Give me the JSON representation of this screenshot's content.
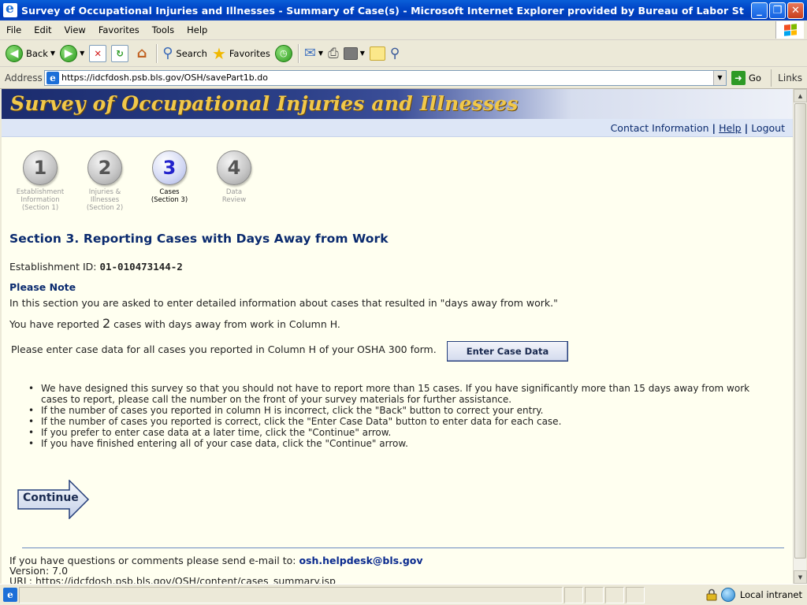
{
  "window": {
    "title": "Survey of Occupational Injuries and Illnesses - Summary of Case(s) - Microsoft Internet Explorer provided by Bureau of Labor St",
    "minimize": "_",
    "maximize": "❐",
    "close": "✕"
  },
  "menu": [
    "File",
    "Edit",
    "View",
    "Favorites",
    "Tools",
    "Help"
  ],
  "toolbar": {
    "back_label": "Back",
    "search_label": "Search",
    "favorites_label": "Favorites"
  },
  "address": {
    "label": "Address",
    "url": "https://idcfdosh.psb.bls.gov/OSH/savePart1b.do",
    "go_label": "Go",
    "links_label": "Links"
  },
  "banner": {
    "title": "Survey of Occupational Injuries and Illnesses"
  },
  "nav": {
    "contact": "Contact Information",
    "sep1": "|",
    "help": "Help",
    "sep2": "|",
    "logout": "Logout"
  },
  "steps": [
    {
      "number": "1",
      "label_line1": "Establishment",
      "label_line2": "Information",
      "label_line3": "(Section 1)",
      "active": false
    },
    {
      "number": "2",
      "label_line1": "Injuries &",
      "label_line2": "Illnesses",
      "label_line3": "(Section 2)",
      "active": false
    },
    {
      "number": "3",
      "label_line1": "Cases",
      "label_line2": "(Section 3)",
      "label_line3": "",
      "active": true
    },
    {
      "number": "4",
      "label_line1": "Data",
      "label_line2": "Review",
      "label_line3": "",
      "active": false
    }
  ],
  "section": {
    "title": "Section 3. Reporting Cases with Days Away from Work",
    "estab_label": "Establishment ID:",
    "estab_id": "01-010473144-2",
    "note_heading": "Please Note",
    "note_text": "In this section you are asked to enter detailed information about cases that resulted in \"days away from work.\"",
    "reported_prefix": "You have reported",
    "reported_count": "2",
    "reported_suffix": "cases with days away from work in Column H.",
    "enter_prompt": "Please enter case data for all cases you reported in Column H of your OSHA 300 form.",
    "enter_button": "Enter Case Data"
  },
  "bullets": [
    "We have designed this survey so that you should not have to report more than 15 cases. If you have significantly more than 15 days away from work cases to report, please call the number on the front of your survey materials for further assistance.",
    "If the number of cases you reported in column H is incorrect, click the \"Back\" button to correct your entry.",
    "If the number of cases you reported is correct, click the \"Enter Case Data\" button to enter data for each case.",
    "If you prefer to enter case data at a later time, click the \"Continue\" arrow.",
    "If you have finished entering all of your case data, click the \"Continue\" arrow."
  ],
  "continue_label": "Continue",
  "footer": {
    "question_text": "If you have questions or comments please send e-mail to:",
    "email": "osh.helpdesk@bls.gov",
    "version": "Version: 7.0",
    "url_line": "URL: https://idcfdosh.psb.bls.gov/OSH/content/cases_summary.jsp"
  },
  "status": {
    "zone": "Local intranet"
  },
  "colors": {
    "banner_text": "#f1c84a",
    "heading_blue": "#0a2a6e",
    "page_bg": "#fffff0",
    "nav_bg": "#dde6f6"
  },
  "icons": [
    "ie-icon",
    "back-icon",
    "forward-icon",
    "stop-icon",
    "refresh-icon",
    "home-icon",
    "search-icon",
    "favorites-icon",
    "history-icon",
    "mail-icon",
    "print-icon",
    "edit-icon",
    "discuss-icon",
    "research-icon",
    "go-icon",
    "lock-icon",
    "globe-icon"
  ]
}
